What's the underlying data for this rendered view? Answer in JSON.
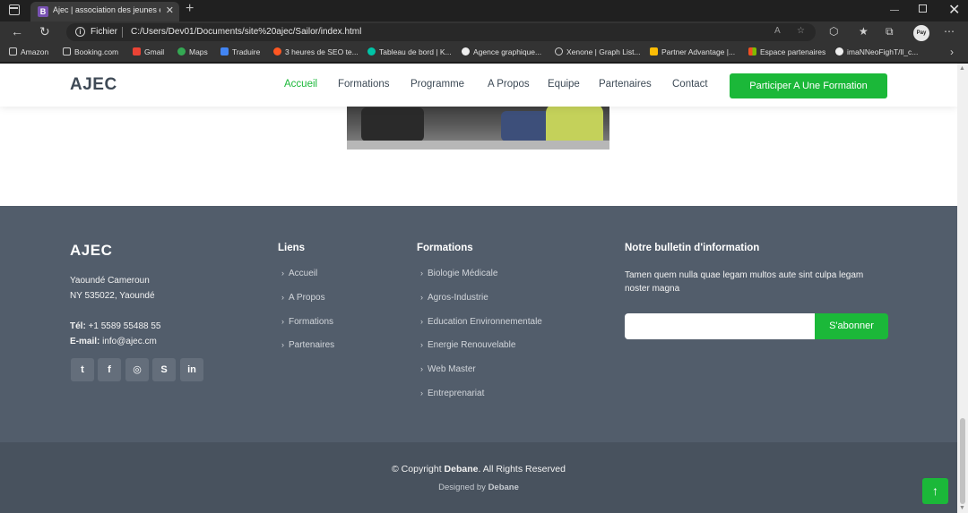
{
  "browser": {
    "tab_title": "Ajec | association des jeunes ent",
    "tab_icon_letter": "B",
    "fichier_label": "Fichier",
    "url": "C:/Users/Dev01/Documents/site%20ajec/Sailor/index.html",
    "profile_label": "Pay",
    "bookmarks": [
      {
        "label": "Amazon",
        "icon": "page-icon",
        "color": "#cfcfcf"
      },
      {
        "label": "Booking.com",
        "icon": "page-icon",
        "color": "#cfcfcf"
      },
      {
        "label": "Gmail",
        "icon": "gmail-icon",
        "color": "#ea4335"
      },
      {
        "label": "Maps",
        "icon": "maps-icon",
        "color": "#34a853"
      },
      {
        "label": "Traduire",
        "icon": "translate-icon",
        "color": "#4285f4"
      },
      {
        "label": "3 heures de SEO te...",
        "icon": "seo-icon",
        "color": "#ff5722"
      },
      {
        "label": "Tableau de bord | K...",
        "icon": "dashboard-icon",
        "color": "#00c4a7"
      },
      {
        "label": "Agence graphique...",
        "icon": "panda-icon",
        "color": "#eeeeee"
      },
      {
        "label": "Xenone | Graph List...",
        "icon": "xenone-icon",
        "color": "#cfcfcf"
      },
      {
        "label": "Partner Advantage |...",
        "icon": "google-cloud-icon",
        "color": "#fbbc05"
      },
      {
        "label": "Espace partenaires",
        "icon": "microsoft-icon",
        "color": "#f25022"
      },
      {
        "label": "imaNNeoFighT/ll_c...",
        "icon": "github-icon",
        "color": "#eeeeee"
      }
    ]
  },
  "header": {
    "logo": "AJEC",
    "nav": [
      "Accueil",
      "Formations",
      "Programme",
      "A Propos",
      "Equipe",
      "Partenaires",
      "Contact"
    ],
    "cta": "Participer A Une Formation"
  },
  "footer": {
    "logo": "AJEC",
    "address_line1": "Yaoundé Cameroun",
    "address_line2": "NY 535022, Yaoundé",
    "phone_label": "Tél:",
    "phone": "+1 5589 55488 55",
    "email_label": "E-mail:",
    "email": "info@ajec.cm",
    "social": [
      "twitter-icon",
      "facebook-icon",
      "instagram-icon",
      "skype-icon",
      "linkedin-icon"
    ],
    "links_title": "Liens",
    "links": [
      "Accueil",
      "A Propos",
      "Formations",
      "Partenaires"
    ],
    "formations_title": "Formations",
    "formations": [
      "Biologie Médicale",
      "Agros-Industrie",
      "Education Environnementale",
      "Energie Renouvelable",
      "Web Master",
      "Entreprenariat"
    ],
    "newsletter_title": "Notre bulletin d'information",
    "newsletter_text": "Tamen quem nulla quae legam multos aute sint culpa legam noster magna",
    "newsletter_input_value": "",
    "newsletter_button": "S'abonner",
    "copyright_prefix": "© Copyright",
    "copyright_brand": "Debane",
    "copyright_suffix": ". All Rights Reserved",
    "designed_prefix": "Designed by",
    "designed_brand": "Debane"
  },
  "colors": {
    "accent": "#1bb839",
    "footer_bg": "#525d6b",
    "footer_bottom_bg": "#48525e"
  }
}
